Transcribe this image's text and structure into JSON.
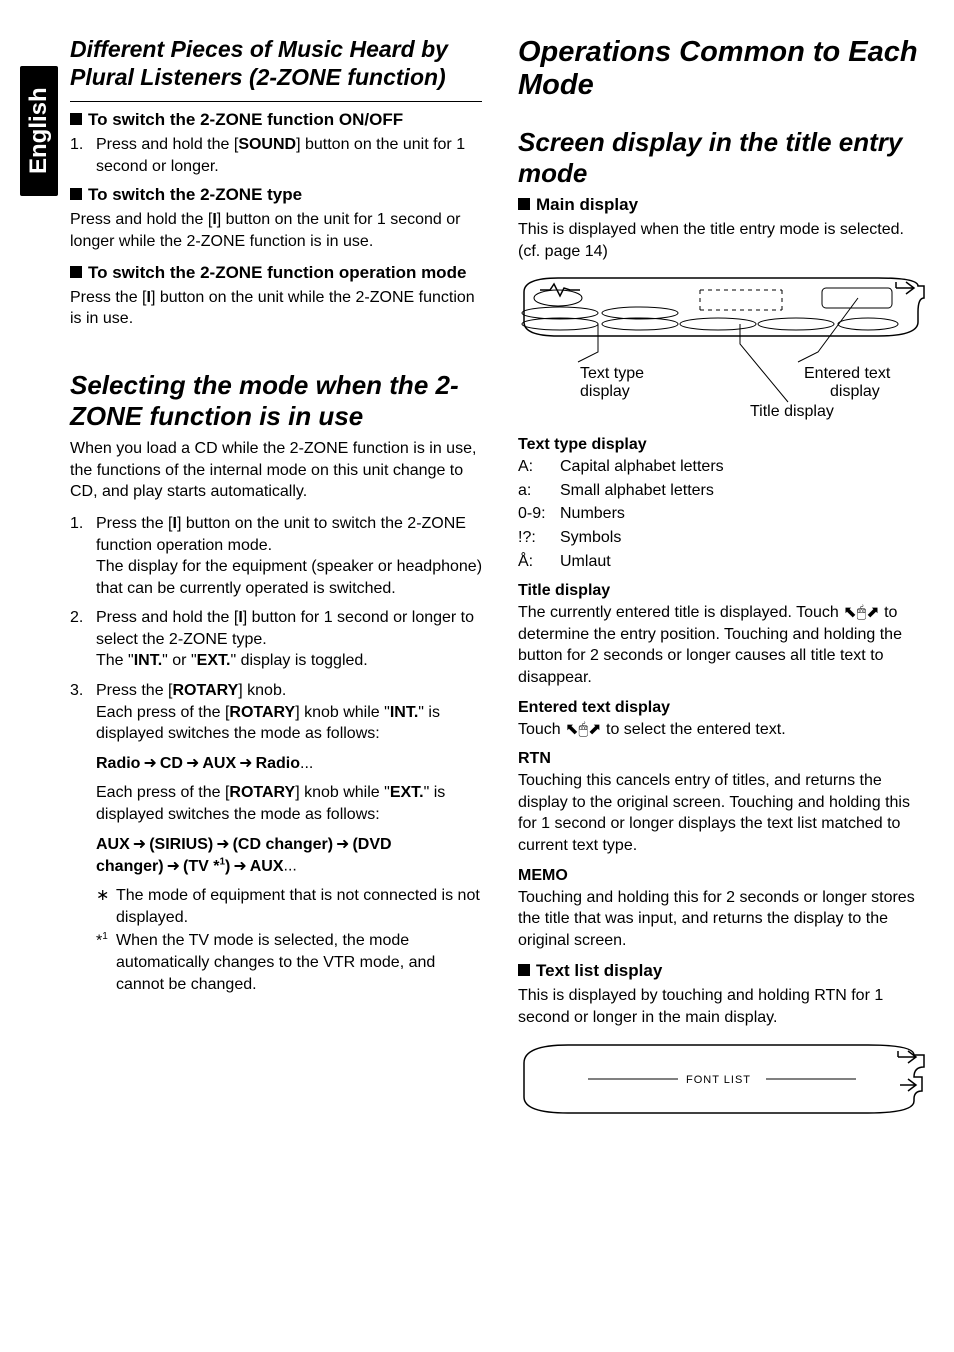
{
  "side_tab": "English",
  "left": {
    "title": "Different Pieces of Music Heard by Plural Listeners (2-ZONE function)",
    "h_onoff": "To switch the 2-ZONE function ON/OFF",
    "onoff_step_marker": "1.",
    "onoff_step": "Press and hold the [SOUND] button on the unit for 1 second or longer.",
    "h_type": "To switch the 2-ZONE type",
    "type_body": "Press and hold the [I] button on the unit for 1 second or longer while the 2-ZONE function is in use.",
    "h_opmode": "To switch the 2-ZONE function operation mode",
    "opmode_body": "Press the [I] button on the unit while the 2-ZONE function is in use.",
    "sel_title": "Selecting the mode when the 2-ZONE function is in use",
    "sel_intro": "When you load a CD while the 2-ZONE function is in use, the functions of the internal mode on this unit change to CD, and play starts automatically.",
    "steps": [
      {
        "n": "1.",
        "t": "Press the [I] button on the unit to switch the 2-ZONE function operation mode.\nThe display for the equipment (speaker or headphone) that can be currently operated is switched."
      },
      {
        "n": "2.",
        "t": "Press and hold the [I] button for 1 second or longer to select the 2-ZONE type.\nThe \"INT.\" or \"EXT.\" display is toggled."
      },
      {
        "n": "3.",
        "t": "Press the [ROTARY] knob.\nEach press of the [ROTARY] knob while \"INT.\" is displayed switches the mode as follows:"
      }
    ],
    "seq1": [
      "Radio",
      "CD",
      "AUX",
      "Radio"
    ],
    "seq_dots": "...",
    "after_seq1": "Each press of the [ROTARY] knob while \"EXT.\" is displayed switches the mode as follows:",
    "seq2": [
      "AUX",
      "(SIRIUS)",
      "(CD changer)",
      "(DVD changer)",
      "(TV *¹)",
      "AUX"
    ],
    "note_ast": "∗",
    "note1": "The mode of equipment that is not connected is not displayed.",
    "note_s1": "*¹",
    "note2": "When the TV mode is selected, the mode automatically changes to the VTR mode, and cannot be changed."
  },
  "right": {
    "chapter": "Operations Common to Each Mode",
    "sub": "Screen display in the title entry mode",
    "h_main": "Main display",
    "main_body": "This is displayed when the title entry mode is selected. (cf. page 14)",
    "fig1": {
      "label_texttype": "Text type display",
      "label_entered": "Entered text display",
      "label_title": "Title display"
    },
    "texttype_head": "Text type display",
    "texttype_rows": [
      {
        "k": "A:",
        "v": "Capital alphabet letters"
      },
      {
        "k": "a:",
        "v": "Small alphabet letters"
      },
      {
        "k": "0-9:",
        "v": "Numbers"
      },
      {
        "k": "!?:",
        "v": "Symbols"
      },
      {
        "k": "Å:",
        "v": "Umlaut"
      }
    ],
    "titledisp_head": "Title display",
    "titledisp_body": "The currently entered title is displayed. Touch ⬉🖱⬈ to determine the entry position. Touching and holding the button for 2 seconds or longer causes all title text to disappear.",
    "entered_head": "Entered text display",
    "entered_body": "Touch ⬉🖱⬈ to select the entered text.",
    "rtn_head": "RTN",
    "rtn_body": "Touching this cancels entry of titles, and returns the display to the original screen. Touching and holding this for 1 second or longer displays the text list matched to current text type.",
    "memo_head": "MEMO",
    "memo_body": "Touching and holding this for 2 seconds or longer stores the title that was input, and returns the display to the original screen.",
    "h_textlist": "Text list display",
    "textlist_body": "This is displayed by touching and holding RTN for 1 second or longer in the main display.",
    "fig2_label": "FONT LIST"
  }
}
